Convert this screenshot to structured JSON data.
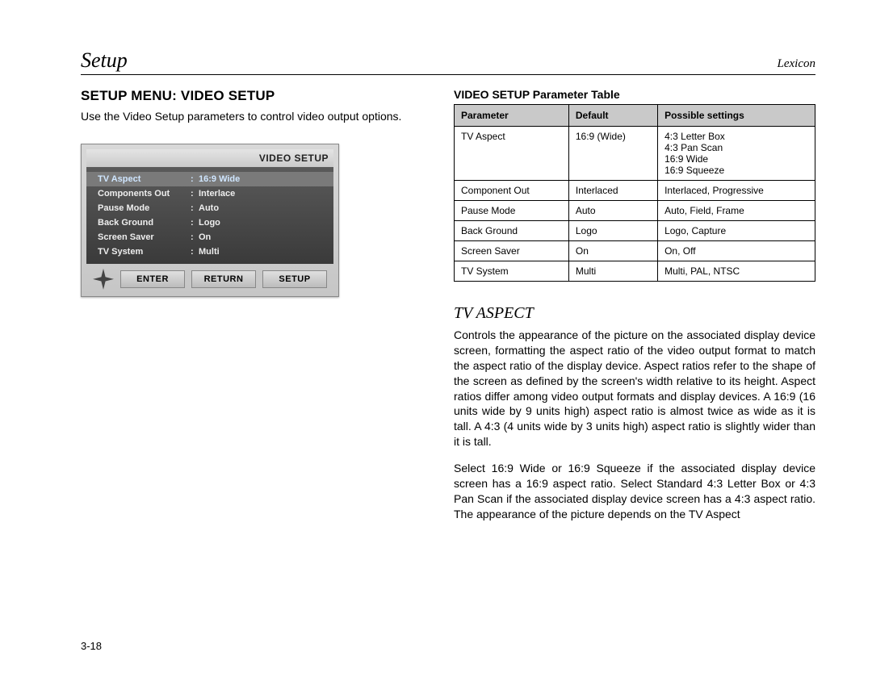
{
  "header": {
    "left": "Setup",
    "right": "Lexicon"
  },
  "left": {
    "section_title": "SETUP MENU: VIDEO SETUP",
    "intro": "Use the Video Setup parameters to control video output options."
  },
  "osd": {
    "title": "VIDEO SETUP",
    "rows": [
      {
        "label": "TV Aspect",
        "value": "16:9  Wide",
        "selected": true
      },
      {
        "label": "Components Out",
        "value": "Interlace",
        "selected": false
      },
      {
        "label": "Pause Mode",
        "value": "Auto",
        "selected": false
      },
      {
        "label": "Back Ground",
        "value": "Logo",
        "selected": false
      },
      {
        "label": "Screen Saver",
        "value": "On",
        "selected": false
      },
      {
        "label": "TV System",
        "value": "Multi",
        "selected": false
      }
    ],
    "buttons": {
      "enter": "ENTER",
      "return": "RETURN",
      "setup": "SETUP"
    }
  },
  "table": {
    "caption": "VIDEO SETUP Parameter Table",
    "headers": {
      "param": "Parameter",
      "default": "Default",
      "possible": "Possible settings"
    },
    "rows": [
      {
        "param": "TV Aspect",
        "default": "16:9 (Wide)",
        "possible": "4:3 Letter Box\n4:3 Pan Scan\n16:9 Wide\n16:9 Squeeze"
      },
      {
        "param": "Component Out",
        "default": "Interlaced",
        "possible": "Interlaced, Progressive"
      },
      {
        "param": "Pause Mode",
        "default": "Auto",
        "possible": "Auto, Field, Frame"
      },
      {
        "param": "Back Ground",
        "default": "Logo",
        "possible": "Logo, Capture"
      },
      {
        "param": "Screen Saver",
        "default": "On",
        "possible": "On, Off"
      },
      {
        "param": "TV System",
        "default": "Multi",
        "possible": "Multi, PAL, NTSC"
      }
    ]
  },
  "tv_aspect": {
    "title": "TV ASPECT",
    "p1": "Controls the appearance of the picture on the associated display device screen, formatting the aspect ratio of the video output format to match the aspect ratio of the display device. Aspect ratios refer to the shape of the screen as defined by the screen's width relative to its height. Aspect ratios differ among video output formats and display devices. A 16:9 (16 units wide by 9 units high) aspect ratio is almost twice as wide as it is tall. A 4:3 (4 units wide by 3 units high) aspect ratio is slightly wider than it is tall.",
    "p2": "Select 16:9 Wide or 16:9 Squeeze if the associated display device screen has a 16:9 aspect ratio. Select Standard 4:3 Letter Box or 4:3 Pan Scan if the associated display device screen has a 4:3 aspect ratio. The appearance of the picture depends on the TV Aspect"
  },
  "page_number": "3-18"
}
